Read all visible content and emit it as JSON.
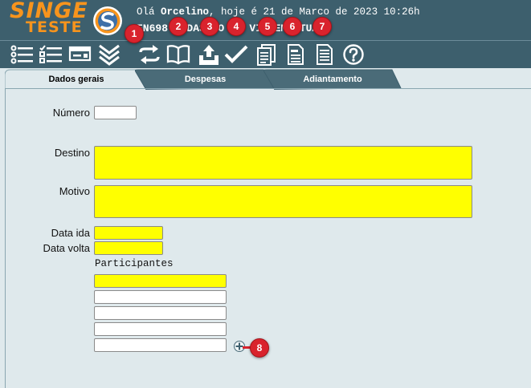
{
  "header": {
    "logo_top": "SINGE",
    "logo_bottom": "TESTE",
    "greeting_prefix": "Olá ",
    "user_name": "Orcelino",
    "greeting_suffix": ", hoje é 21 de Marco de 2023 10:26h",
    "screen_title": "FN698 CADASTRO DE VIAGEM ATUAL"
  },
  "toolbar": {
    "icons": [
      "list-icon",
      "checklist-icon",
      "card-icon",
      "double-chevron-down-icon",
      "swap-icon",
      "book-icon",
      "upload-icon",
      "check-icon",
      "documents-icon",
      "document-icon",
      "report-icon",
      "help-icon"
    ]
  },
  "markers": [
    "1",
    "2",
    "3",
    "4",
    "5",
    "6",
    "7",
    "8"
  ],
  "tabs": [
    {
      "label": "Dados gerais",
      "active": true
    },
    {
      "label": "Despesas",
      "active": false
    },
    {
      "label": "Adiantamento",
      "active": false
    }
  ],
  "form": {
    "numero_label": "Número",
    "numero_value": "",
    "destino_label": "Destino",
    "destino_value": "",
    "motivo_label": "Motivo",
    "motivo_value": "",
    "data_ida_label": "Data ida",
    "data_ida_value": "",
    "data_volta_label": "Data volta",
    "data_volta_value": "",
    "participantes_label": "Participantes",
    "participantes": [
      "",
      "",
      "",
      "",
      ""
    ]
  },
  "colors": {
    "header_bg": "#3d5f6d",
    "logo_orange": "#f7941d",
    "required_field": "#ffff00",
    "marker_red": "#d9232d",
    "content_bg": "#dfe9ec"
  }
}
